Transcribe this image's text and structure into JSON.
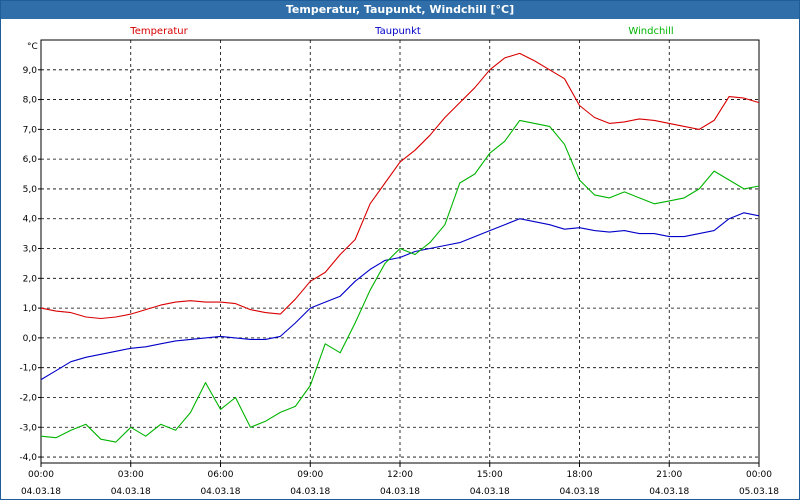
{
  "window": {
    "title": "Temperatur, Taupunkt, Windchill [°C]"
  },
  "chart_data": {
    "type": "line",
    "title": "Temperatur, Taupunkt, Windchill [°C]",
    "ylabel": "°C",
    "ylim": [
      -4.2,
      10.0
    ],
    "yticks": [
      "9,0",
      "8,0",
      "7,0",
      "6,0",
      "5,0",
      "4,0",
      "3,0",
      "2,0",
      "1,0",
      "0,0",
      "-1,0",
      "-2,0",
      "-3,0",
      "-4,0"
    ],
    "ytick_values": [
      9,
      8,
      7,
      6,
      5,
      4,
      3,
      2,
      1,
      0,
      -1,
      -2,
      -3,
      -4
    ],
    "xlim": [
      0,
      24
    ],
    "xticks": [
      {
        "x": 0,
        "time": "00:00",
        "date": "04.03.18"
      },
      {
        "x": 3,
        "time": "03:00",
        "date": "04.03.18"
      },
      {
        "x": 6,
        "time": "06:00",
        "date": "04.03.18"
      },
      {
        "x": 9,
        "time": "09:00",
        "date": "04.03.18"
      },
      {
        "x": 12,
        "time": "12:00",
        "date": "04.03.18"
      },
      {
        "x": 15,
        "time": "15:00",
        "date": "04.03.18"
      },
      {
        "x": 18,
        "time": "18:00",
        "date": "04.03.18"
      },
      {
        "x": 21,
        "time": "21:00",
        "date": "04.03.18"
      },
      {
        "x": 24,
        "time": "00:00",
        "date": "05.03.18"
      }
    ],
    "grid": true,
    "legend": "top",
    "series": [
      {
        "name": "Temperatur",
        "color": "#d80000",
        "points": [
          [
            0,
            1.0
          ],
          [
            0.5,
            0.9
          ],
          [
            1,
            0.85
          ],
          [
            1.5,
            0.7
          ],
          [
            2,
            0.65
          ],
          [
            2.5,
            0.7
          ],
          [
            3,
            0.8
          ],
          [
            3.5,
            0.95
          ],
          [
            4,
            1.1
          ],
          [
            4.5,
            1.2
          ],
          [
            5,
            1.25
          ],
          [
            5.5,
            1.2
          ],
          [
            6,
            1.2
          ],
          [
            6.5,
            1.15
          ],
          [
            7,
            0.95
          ],
          [
            7.5,
            0.85
          ],
          [
            8,
            0.8
          ],
          [
            8.5,
            1.3
          ],
          [
            9,
            1.9
          ],
          [
            9.5,
            2.2
          ],
          [
            10,
            2.8
          ],
          [
            10.5,
            3.3
          ],
          [
            11,
            4.5
          ],
          [
            11.5,
            5.2
          ],
          [
            12,
            5.9
          ],
          [
            12.5,
            6.3
          ],
          [
            13,
            6.8
          ],
          [
            13.5,
            7.4
          ],
          [
            14,
            7.9
          ],
          [
            14.5,
            8.4
          ],
          [
            15,
            9.0
          ],
          [
            15.5,
            9.4
          ],
          [
            16,
            9.55
          ],
          [
            16.5,
            9.3
          ],
          [
            17,
            9.0
          ],
          [
            17.5,
            8.7
          ],
          [
            18,
            7.8
          ],
          [
            18.5,
            7.4
          ],
          [
            19,
            7.2
          ],
          [
            19.5,
            7.25
          ],
          [
            20,
            7.35
          ],
          [
            20.5,
            7.3
          ],
          [
            21,
            7.2
          ],
          [
            21.5,
            7.1
          ],
          [
            22,
            7.0
          ],
          [
            22.5,
            7.3
          ],
          [
            23,
            8.1
          ],
          [
            23.5,
            8.05
          ],
          [
            24,
            7.9
          ]
        ]
      },
      {
        "name": "Taupunkt",
        "color": "#0000c8",
        "points": [
          [
            0,
            -1.4
          ],
          [
            0.5,
            -1.1
          ],
          [
            1,
            -0.8
          ],
          [
            1.5,
            -0.65
          ],
          [
            2,
            -0.55
          ],
          [
            2.5,
            -0.45
          ],
          [
            3,
            -0.35
          ],
          [
            3.5,
            -0.3
          ],
          [
            4,
            -0.2
          ],
          [
            4.5,
            -0.1
          ],
          [
            5,
            -0.05
          ],
          [
            5.5,
            0.0
          ],
          [
            6,
            0.05
          ],
          [
            6.5,
            0.0
          ],
          [
            7,
            -0.05
          ],
          [
            7.5,
            -0.05
          ],
          [
            8,
            0.05
          ],
          [
            8.5,
            0.5
          ],
          [
            9,
            1.0
          ],
          [
            9.5,
            1.2
          ],
          [
            10,
            1.4
          ],
          [
            10.5,
            1.9
          ],
          [
            11,
            2.3
          ],
          [
            11.5,
            2.6
          ],
          [
            12,
            2.7
          ],
          [
            12.5,
            2.9
          ],
          [
            13,
            3.0
          ],
          [
            13.5,
            3.1
          ],
          [
            14,
            3.2
          ],
          [
            14.5,
            3.4
          ],
          [
            15,
            3.6
          ],
          [
            15.5,
            3.8
          ],
          [
            16,
            4.0
          ],
          [
            16.5,
            3.9
          ],
          [
            17,
            3.8
          ],
          [
            17.5,
            3.65
          ],
          [
            18,
            3.7
          ],
          [
            18.5,
            3.6
          ],
          [
            19,
            3.55
          ],
          [
            19.5,
            3.6
          ],
          [
            20,
            3.5
          ],
          [
            20.5,
            3.5
          ],
          [
            21,
            3.4
          ],
          [
            21.5,
            3.4
          ],
          [
            22,
            3.5
          ],
          [
            22.5,
            3.6
          ],
          [
            23,
            4.0
          ],
          [
            23.5,
            4.2
          ],
          [
            24,
            4.1
          ]
        ]
      },
      {
        "name": "Windchill",
        "color": "#00b400",
        "points": [
          [
            0,
            -3.3
          ],
          [
            0.5,
            -3.35
          ],
          [
            1,
            -3.1
          ],
          [
            1.5,
            -2.9
          ],
          [
            2,
            -3.4
          ],
          [
            2.5,
            -3.5
          ],
          [
            3,
            -3.0
          ],
          [
            3.5,
            -3.3
          ],
          [
            4,
            -2.9
          ],
          [
            4.5,
            -3.1
          ],
          [
            5,
            -2.5
          ],
          [
            5.5,
            -1.5
          ],
          [
            6,
            -2.4
          ],
          [
            6.5,
            -2.0
          ],
          [
            7,
            -3.0
          ],
          [
            7.5,
            -2.8
          ],
          [
            8,
            -2.5
          ],
          [
            8.5,
            -2.3
          ],
          [
            9,
            -1.6
          ],
          [
            9.5,
            -0.2
          ],
          [
            10,
            -0.5
          ],
          [
            10.5,
            0.5
          ],
          [
            11,
            1.6
          ],
          [
            11.5,
            2.5
          ],
          [
            12,
            3.0
          ],
          [
            12.5,
            2.8
          ],
          [
            13,
            3.2
          ],
          [
            13.5,
            3.8
          ],
          [
            14,
            5.2
          ],
          [
            14.5,
            5.5
          ],
          [
            15,
            6.2
          ],
          [
            15.5,
            6.6
          ],
          [
            16,
            7.3
          ],
          [
            16.5,
            7.2
          ],
          [
            17,
            7.1
          ],
          [
            17.5,
            6.5
          ],
          [
            18,
            5.3
          ],
          [
            18.5,
            4.8
          ],
          [
            19,
            4.7
          ],
          [
            19.5,
            4.9
          ],
          [
            20,
            4.7
          ],
          [
            20.5,
            4.5
          ],
          [
            21,
            4.6
          ],
          [
            21.5,
            4.7
          ],
          [
            22,
            5.0
          ],
          [
            22.5,
            5.6
          ],
          [
            23,
            5.3
          ],
          [
            23.5,
            5.0
          ],
          [
            24,
            5.1
          ]
        ]
      }
    ]
  }
}
